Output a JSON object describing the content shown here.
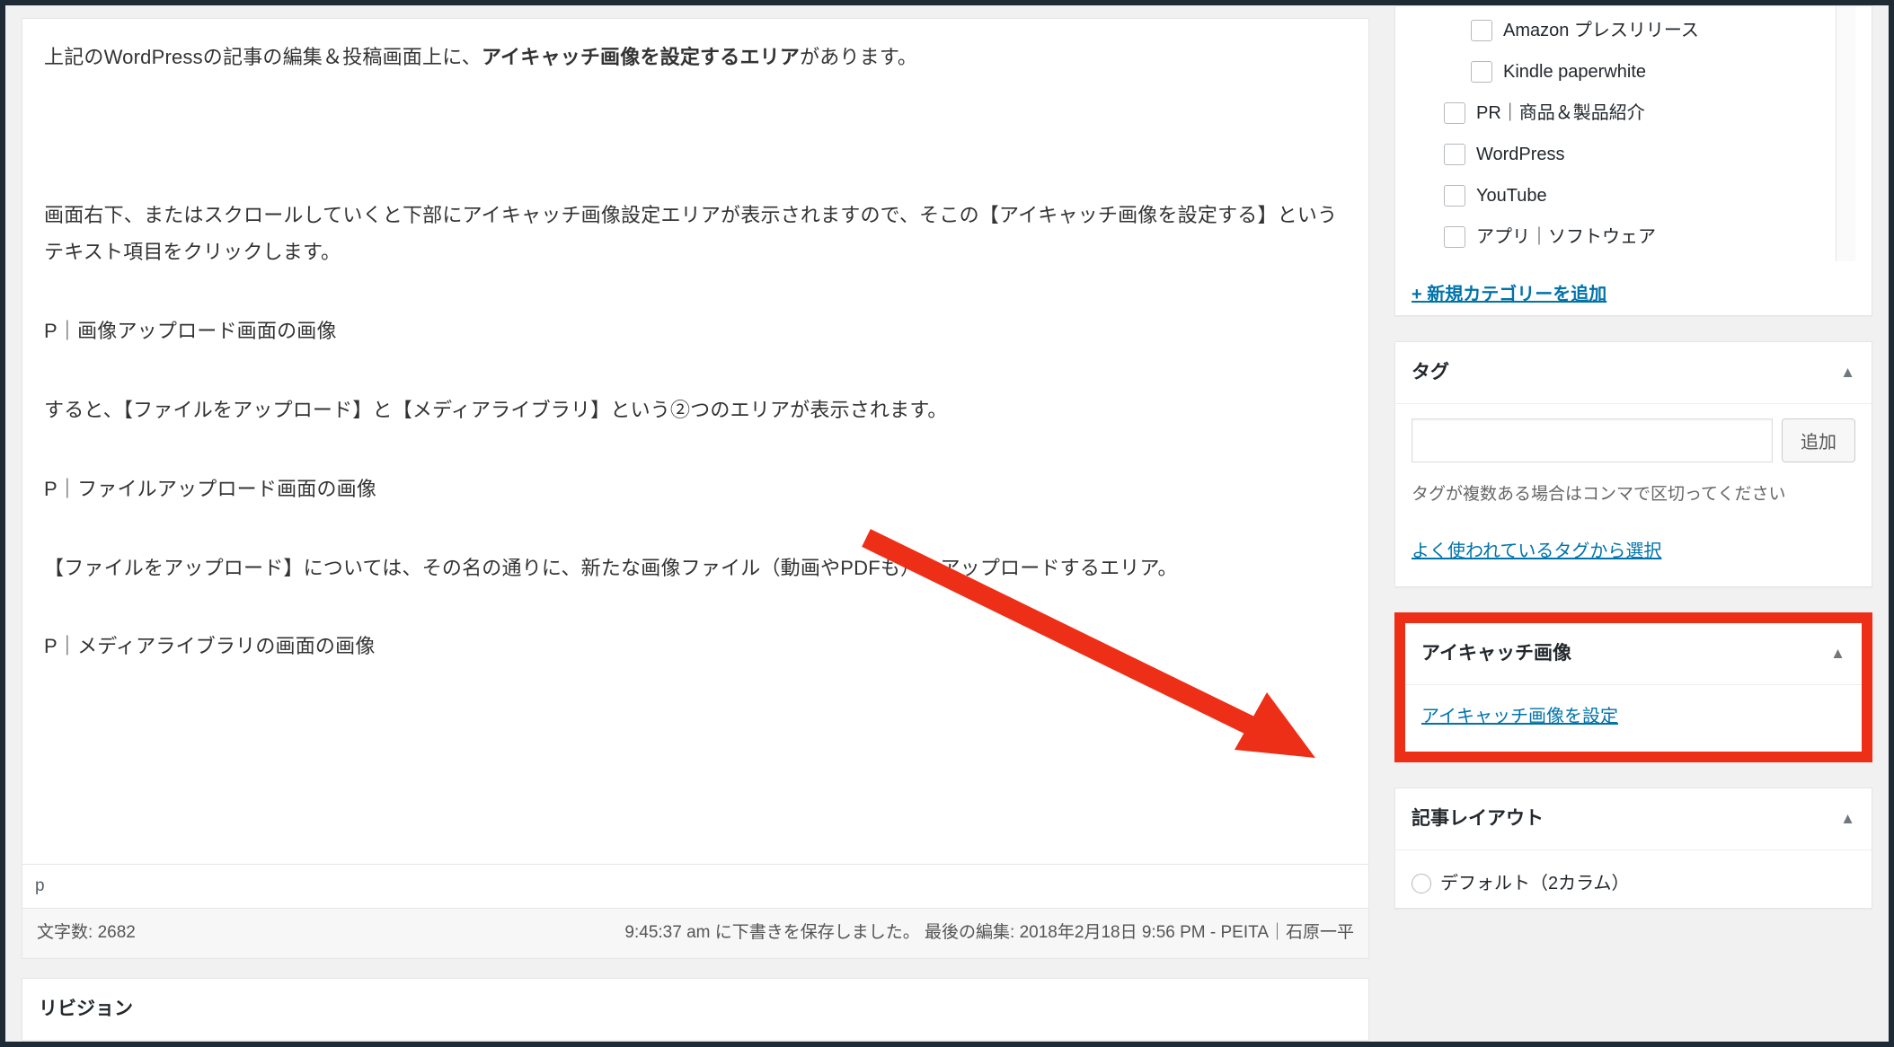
{
  "editor": {
    "p1a": "上記のWordPressの記事の編集＆投稿画面上に、",
    "p1b": "アイキャッチ画像を設定するエリア",
    "p1c": "があります。",
    "p2": "画面右下、またはスクロールしていくと下部にアイキャッチ画像設定エリアが表示されますので、そこの【アイキャッチ画像を設定する】というテキスト項目をクリックします。",
    "p3": "P｜画像アップロード画面の画像",
    "p4": "すると、【ファイルをアップロード】と【メディアライブラリ】という②つのエリアが表示されます。",
    "p5": "P｜ファイルアップロード画面の画像",
    "p6": "【ファイルをアップロード】については、その名の通りに、新たな画像ファイル（動画やPDFも）をアップロードするエリア。",
    "p7": "P｜メディアライブラリの画面の画像",
    "path": "p",
    "wordcount_label": "文字数: ",
    "wordcount_value": "2682",
    "save_status": "9:45:37 am に下書きを保存しました。",
    "last_edit": "最後の編集: 2018年2月18日 9:56 PM - PEITA｜石原一平"
  },
  "revisions": {
    "title": "リビジョン"
  },
  "categories": {
    "items": [
      {
        "label": "Amazon プレスリリース",
        "indent": 2
      },
      {
        "label": "Kindle paperwhite",
        "indent": 2
      },
      {
        "label": "PR｜商品＆製品紹介",
        "indent": 1
      },
      {
        "label": "WordPress",
        "indent": 1
      },
      {
        "label": "YouTube",
        "indent": 1
      },
      {
        "label": "アプリ｜ソフトウェア",
        "indent": 1
      }
    ],
    "add_new": "+ 新規カテゴリーを追加"
  },
  "tags": {
    "title": "タグ",
    "add_button": "追加",
    "howto": "タグが複数ある場合はコンマで区切ってください",
    "choose_link": "よく使われているタグから選択"
  },
  "featured": {
    "title": "アイキャッチ画像",
    "set_link": "アイキャッチ画像を設定"
  },
  "layout": {
    "title": "記事レイアウト",
    "option1": "デフォルト（2カラム）"
  }
}
